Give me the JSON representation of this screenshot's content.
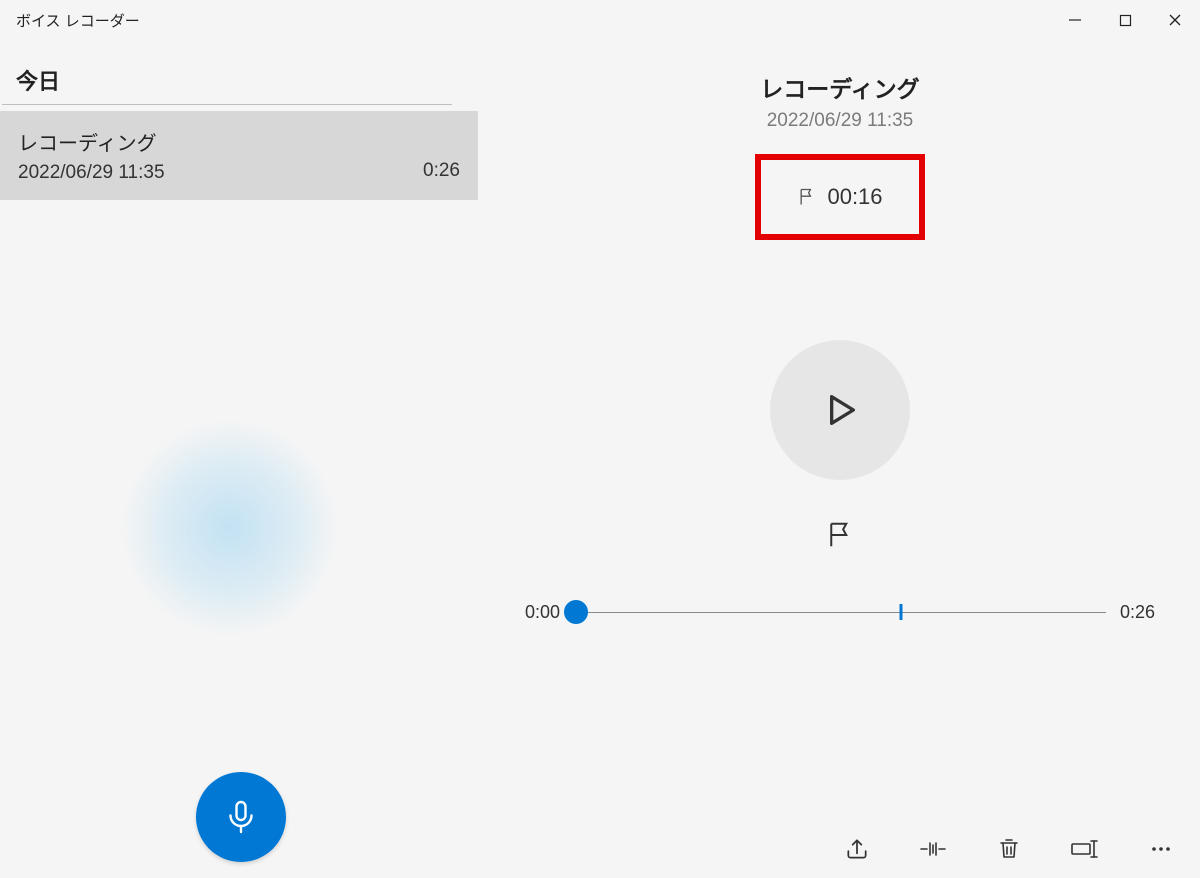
{
  "titlebar": {
    "title": "ボイス レコーダー"
  },
  "sidebar": {
    "section_label": "今日",
    "recordings": [
      {
        "title": "レコーディング",
        "datetime": "2022/06/29 11:35",
        "duration": "0:26"
      }
    ]
  },
  "main": {
    "title": "レコーディング",
    "datetime": "2022/06/29 11:35",
    "marker_time": "00:16",
    "timeline": {
      "start": "0:00",
      "end": "0:26"
    }
  },
  "colors": {
    "accent": "#0078d4",
    "highlight_box": "#e40000"
  }
}
